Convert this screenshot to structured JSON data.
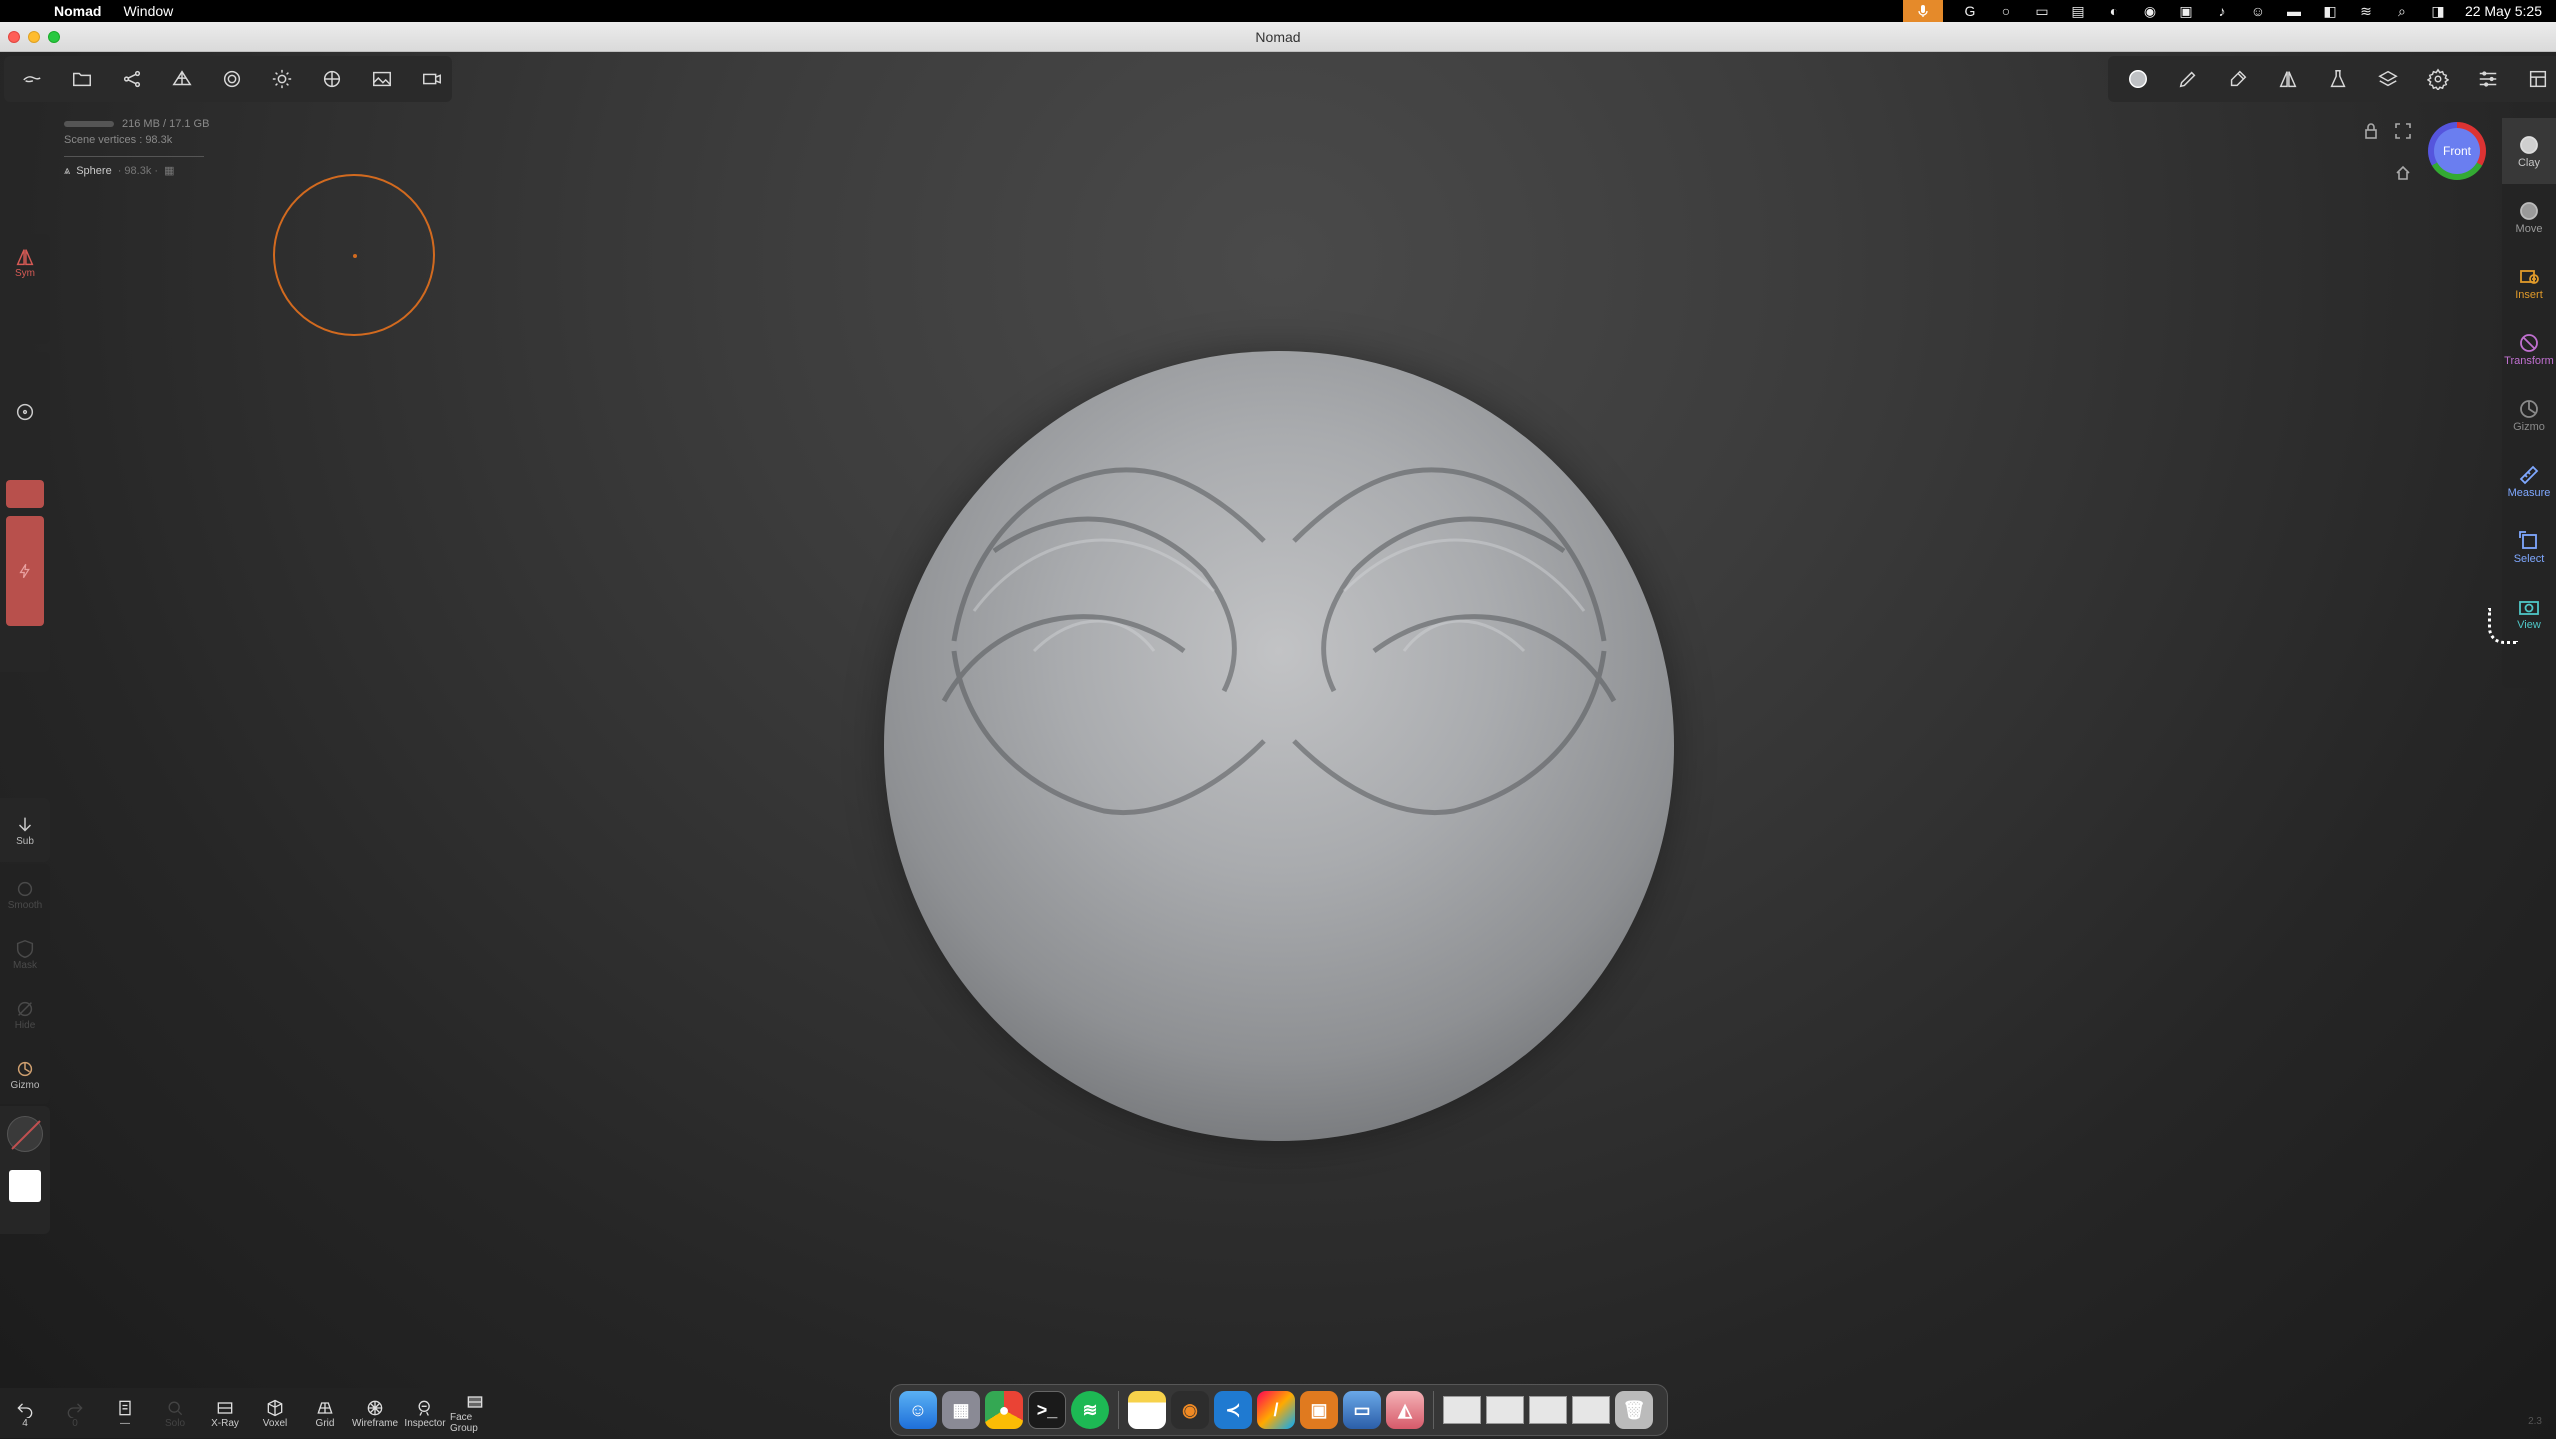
{
  "menubar": {
    "app_name": "Nomad",
    "menus": [
      "Window"
    ],
    "clock": "22 May  5:25",
    "status_icons": [
      "mic-icon",
      "grammarly-icon",
      "circle-icon",
      "display-icon",
      "battery-indicator-icon",
      "volume-icon",
      "focus-icon",
      "screen-icon",
      "sound-icon",
      "user-icon",
      "battery-icon",
      "control-center-icon",
      "wifi-icon",
      "search-icon",
      "control-icon"
    ]
  },
  "window": {
    "title": "Nomad"
  },
  "top_toolbar_left": {
    "icons": [
      "menu-icon",
      "folder-icon",
      "scene-graph-icon",
      "topology-icon",
      "material-icon",
      "light-icon",
      "render-icon",
      "background-icon",
      "camera-icon"
    ]
  },
  "top_toolbar_right": {
    "icons": [
      "material-sphere-icon",
      "brush-icon",
      "paint-icon",
      "symmetry-icon",
      "flask-icon",
      "layers-icon",
      "settings-icon",
      "sliders-icon",
      "interface-icon"
    ]
  },
  "info": {
    "memory": "216 MB / 17.1 GB",
    "scene_vertices": "Scene vertices : 98.3k",
    "object_name": "Sphere",
    "object_verts": "· 98.3k ·"
  },
  "left_rail": {
    "sym_label": "Sym",
    "sub_label": "Sub",
    "smooth_label": "Smooth",
    "mask_label": "Mask",
    "hide_label": "Hide",
    "gizmo_label": "Gizmo"
  },
  "right_rail": {
    "tools": [
      {
        "label": "Clay",
        "icon": "clay-icon",
        "color": "#c8c8c8"
      },
      {
        "label": "Move",
        "icon": "move-icon",
        "color": "#9a9a9a"
      },
      {
        "label": "Insert",
        "icon": "insert-icon",
        "color": "#e09a2a"
      },
      {
        "label": "Transform",
        "icon": "transform-icon",
        "color": "#c070d0"
      },
      {
        "label": "Gizmo",
        "icon": "gizmo-icon",
        "color": "#8a8a8a"
      },
      {
        "label": "Measure",
        "icon": "measure-icon",
        "color": "#7fa8ff"
      },
      {
        "label": "Select",
        "icon": "select-icon",
        "color": "#7fa8ff"
      },
      {
        "label": "View",
        "icon": "view-icon",
        "color": "#4fc7c7"
      }
    ]
  },
  "view_gizmo": {
    "label": "Front"
  },
  "bottom_toolbar": {
    "undo_count": "4",
    "redo_count": "0",
    "history_label": "—",
    "solo_label": "Solo",
    "buttons": [
      "X-Ray",
      "Voxel",
      "Grid",
      "Wireframe",
      "Inspector",
      "Face Group"
    ]
  },
  "dock": {
    "apps": [
      "Finder",
      "Launchpad",
      "Chrome",
      "Terminal",
      "Spotify",
      "Notes",
      "Blender",
      "VS Code",
      "Nomad",
      "Preview",
      "Photos",
      "Nomad Sculpt"
    ]
  },
  "version": "2.3",
  "colors": {
    "accent_orange": "#d26a1f",
    "sym_red": "#d65a55",
    "active_red": "#b8504c"
  }
}
